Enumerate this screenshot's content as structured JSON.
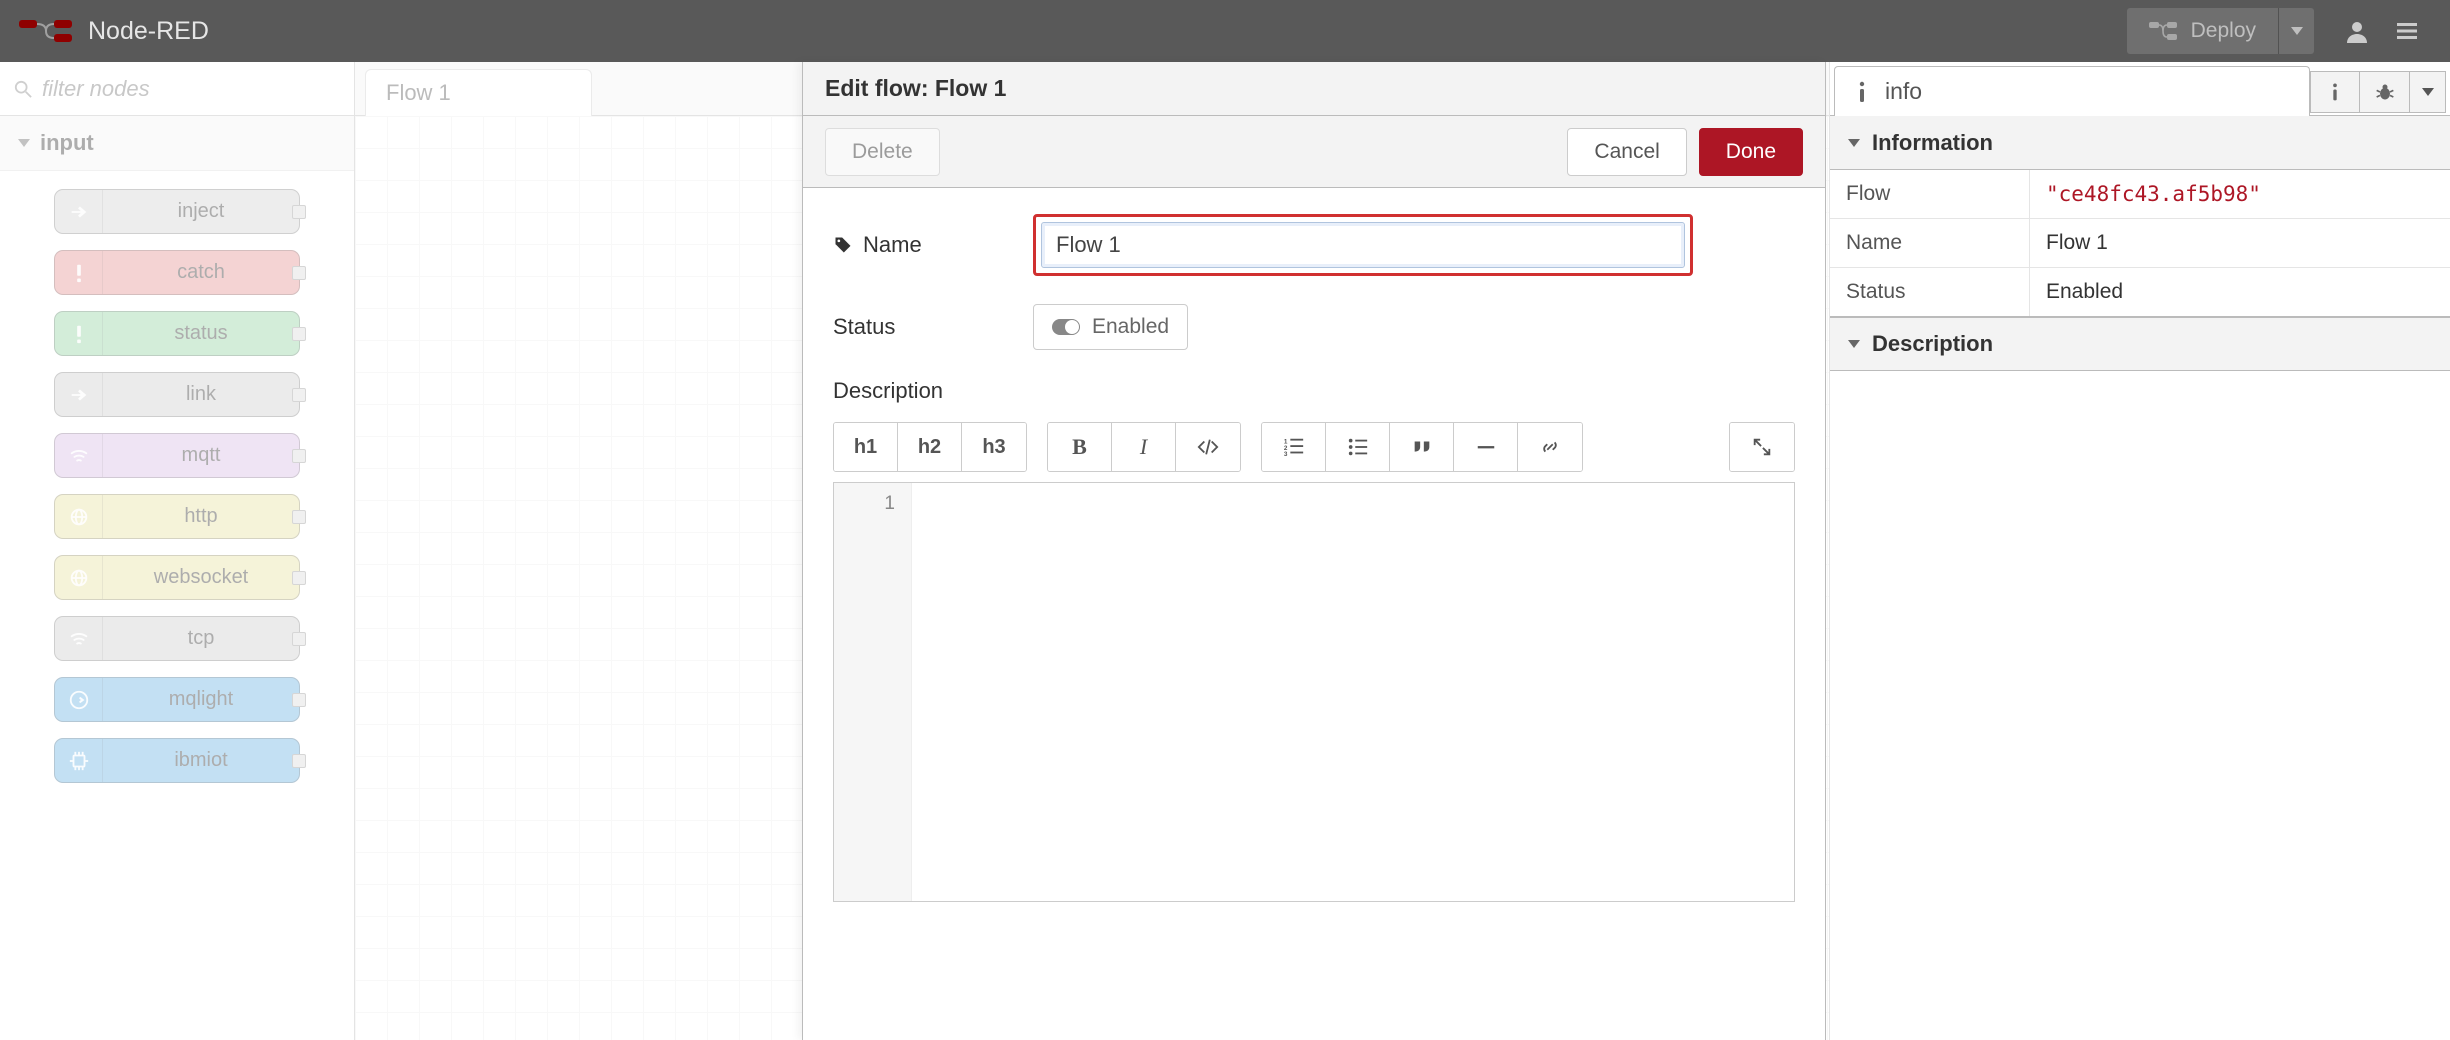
{
  "header": {
    "title": "Node-RED",
    "deploy_label": "Deploy"
  },
  "palette": {
    "filter_placeholder": "filter nodes",
    "category": "input",
    "nodes": [
      {
        "label": "inject",
        "color": "gray",
        "icon": "arrow"
      },
      {
        "label": "catch",
        "color": "red",
        "icon": "bang"
      },
      {
        "label": "status",
        "color": "green",
        "icon": "bang"
      },
      {
        "label": "link",
        "color": "grayL",
        "icon": "arrow"
      },
      {
        "label": "mqtt",
        "color": "purple",
        "icon": "wifi"
      },
      {
        "label": "http",
        "color": "olive",
        "icon": "globe"
      },
      {
        "label": "websocket",
        "color": "olive",
        "icon": "globe"
      },
      {
        "label": "tcp",
        "color": "grayL",
        "icon": "wifi"
      },
      {
        "label": "mqlight",
        "color": "blue",
        "icon": "arrowC"
      },
      {
        "label": "ibmiot",
        "color": "blue",
        "icon": "chip"
      }
    ]
  },
  "workspace": {
    "tabs": [
      "Flow 1"
    ]
  },
  "tray": {
    "title": "Edit flow: Flow 1",
    "delete_label": "Delete",
    "cancel_label": "Cancel",
    "done_label": "Done",
    "name_field_label": "Name",
    "name_value": "Flow 1",
    "status_field_label": "Status",
    "status_toggle_label": "Enabled",
    "description_label": "Description",
    "editor_buttons": {
      "h1": "h1",
      "h2": "h2",
      "h3": "h3"
    },
    "editor_line": "1"
  },
  "sidebar": {
    "tab_label": "info",
    "section_info": "Information",
    "rows": {
      "flow_k": "Flow",
      "flow_v": "\"ce48fc43.af5b98\"",
      "name_k": "Name",
      "name_v": "Flow 1",
      "status_k": "Status",
      "status_v": "Enabled"
    },
    "section_desc": "Description"
  }
}
